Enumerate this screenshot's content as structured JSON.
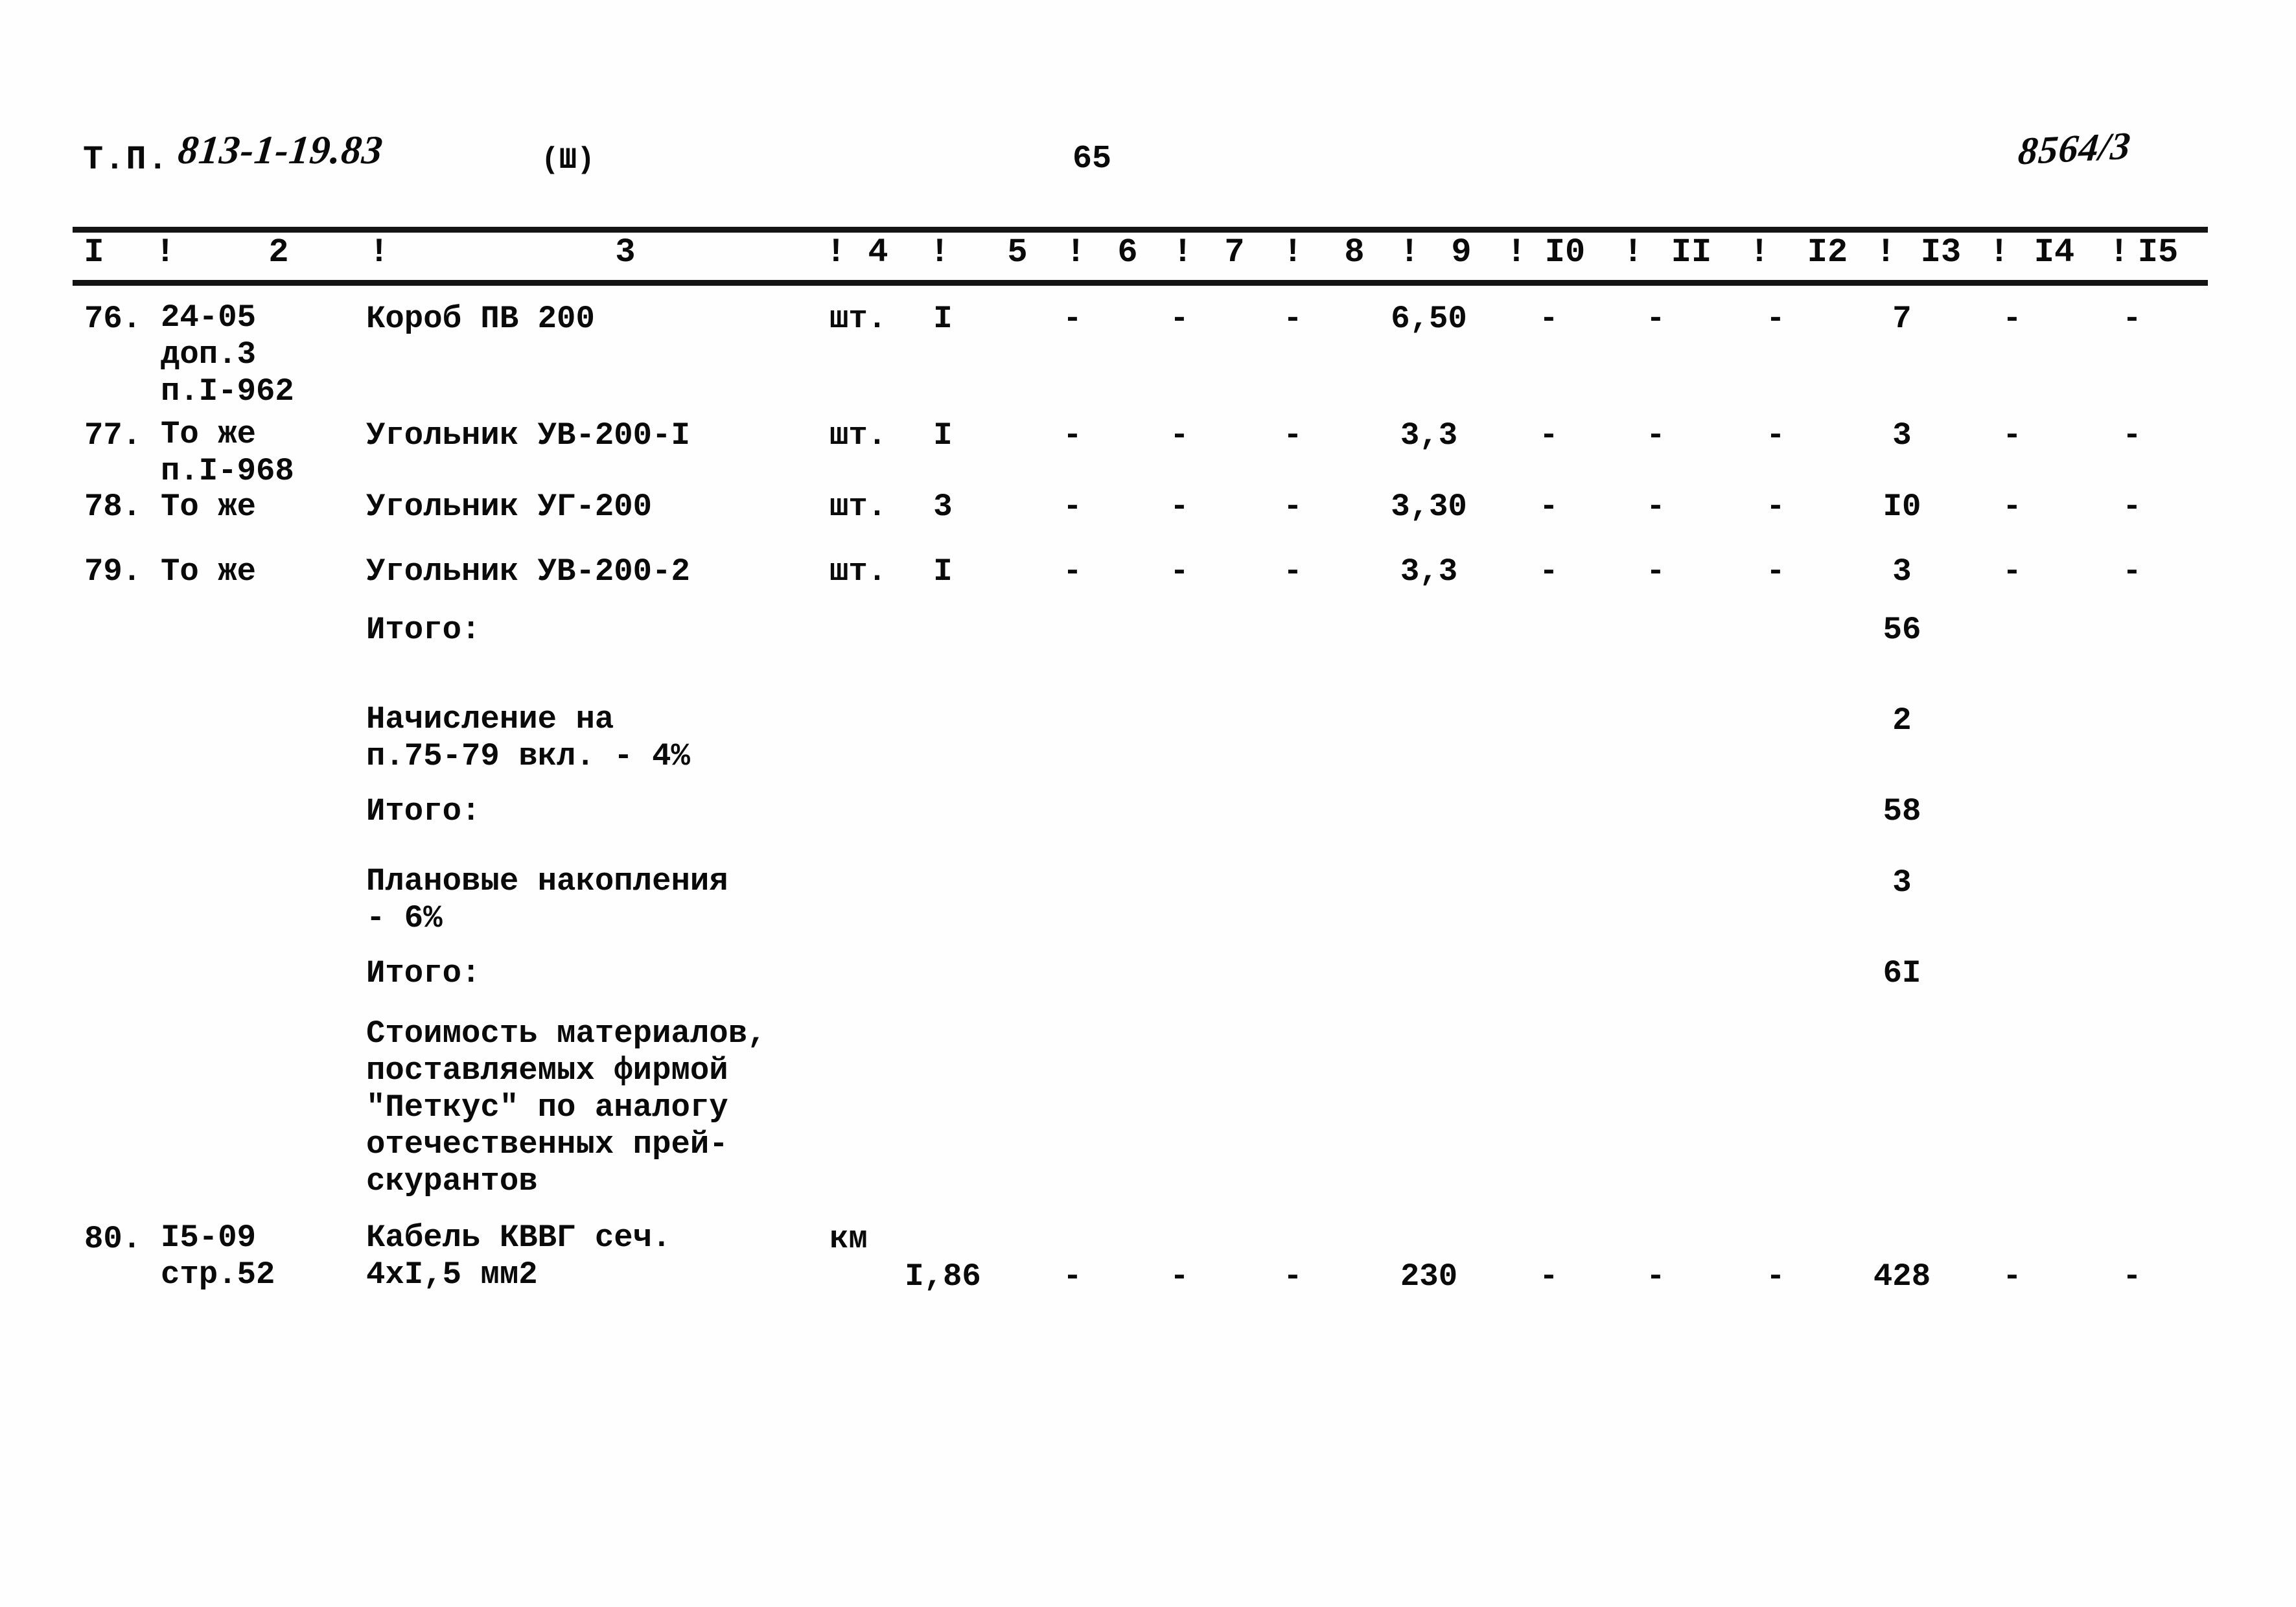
{
  "header": {
    "doc_prefix": "Т.П.",
    "doc_code": "813-1-19.83",
    "part": "(Ш)",
    "page_number": "65",
    "stamp": "8564/3"
  },
  "table": {
    "column_headers": [
      "I",
      "2",
      "3",
      "4",
      "5",
      "6",
      "7",
      "8",
      "9",
      "I0",
      "II",
      "I2",
      "I3",
      "I4",
      "I5"
    ],
    "separator": "!",
    "rows": [
      {
        "kind": "item",
        "no": "76.",
        "ref": "24-05\nдоп.3\nп.I-962",
        "name": "Короб ПВ 200",
        "unit": "шт.",
        "c4": "I",
        "c5": "-",
        "c6": "-",
        "c7": "-",
        "c8": "6,50",
        "c9": "-",
        "c10": "-",
        "c11": "-",
        "c12": "7",
        "c13": "-",
        "c14": "-"
      },
      {
        "kind": "item",
        "no": "77.",
        "ref": "То же\nп.I-968",
        "name": "Угольник УВ-200-I",
        "unit": "шт.",
        "c4": "I",
        "c5": "-",
        "c6": "-",
        "c7": "-",
        "c8": "3,3",
        "c9": "-",
        "c10": "-",
        "c11": "-",
        "c12": "3",
        "c13": "-",
        "c14": "-"
      },
      {
        "kind": "item",
        "no": "78.",
        "ref": "То же",
        "name": "Угольник УГ-200",
        "unit": "шт.",
        "c4": "3",
        "c5": "-",
        "c6": "-",
        "c7": "-",
        "c8": "3,30",
        "c9": "-",
        "c10": "-",
        "c11": "-",
        "c12": "I0",
        "c13": "-",
        "c14": "-"
      },
      {
        "kind": "item",
        "no": "79.",
        "ref": "То же",
        "name": "Угольник УВ-200-2",
        "unit": "шт.",
        "c4": "I",
        "c5": "-",
        "c6": "-",
        "c7": "-",
        "c8": "3,3",
        "c9": "-",
        "c10": "-",
        "c11": "-",
        "c12": "3",
        "c13": "-",
        "c14": "-"
      },
      {
        "kind": "subtotal",
        "name": "Итого:",
        "c12": "56"
      },
      {
        "kind": "subtotal",
        "name": "Начисление на\nп.75-79 вкл. - 4%",
        "c12": "2"
      },
      {
        "kind": "subtotal",
        "name": "Итого:",
        "c12": "58"
      },
      {
        "kind": "subtotal",
        "name": "Плановые накопления\n- 6%",
        "c12": "3"
      },
      {
        "kind": "subtotal",
        "name": "Итого:",
        "c12": "6I"
      },
      {
        "kind": "note",
        "name": "Стоимость материалов,\nпоставляемых фирмой\n\"Петкус\" по аналогу\nотечественных прей-\nскурантов"
      },
      {
        "kind": "item",
        "no": "80.",
        "ref": "I5-09\nстр.52",
        "name": "Кабель КВВГ сеч.\n4xI,5 мм2",
        "unit": "км",
        "c4": "I,86",
        "c5": "-",
        "c6": "-",
        "c7": "-",
        "c8": "230",
        "c9": "-",
        "c10": "-",
        "c11": "-",
        "c12": "428",
        "c13": "-",
        "c14": "-"
      }
    ]
  }
}
